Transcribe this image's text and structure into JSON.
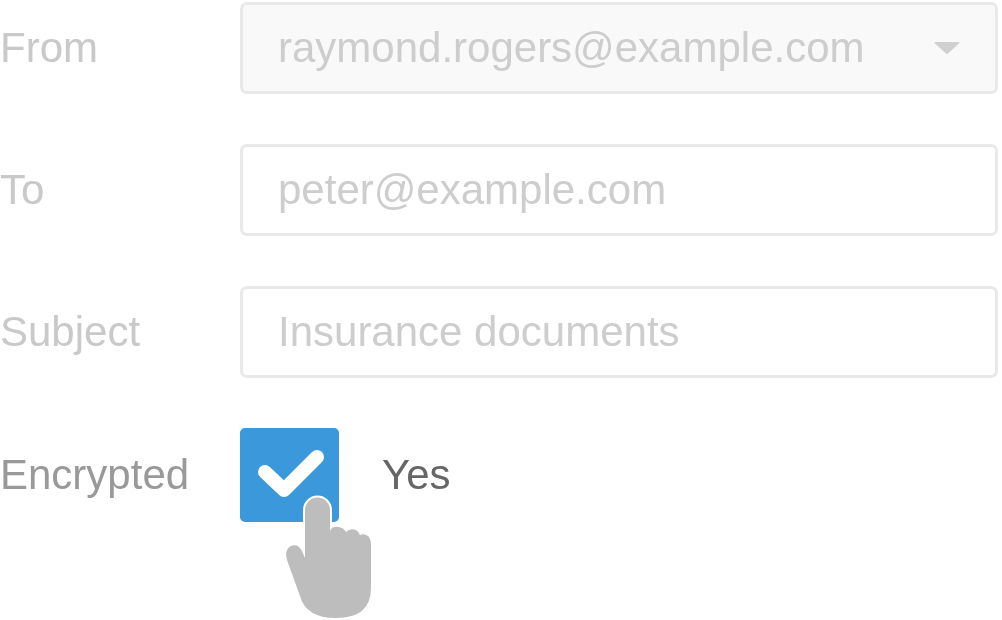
{
  "fields": [
    {
      "kind": "select",
      "label": "From",
      "value": "raymond.rogers@example.com",
      "disabled": true
    },
    {
      "kind": "text",
      "label": "To",
      "value": "peter@example.com",
      "disabled": true
    },
    {
      "kind": "text",
      "label": "Subject",
      "value": "Insurance documents",
      "disabled": true
    },
    {
      "kind": "checkbox",
      "label": "Encrypted",
      "option": "Yes",
      "checked": true,
      "disabled": false
    }
  ]
}
